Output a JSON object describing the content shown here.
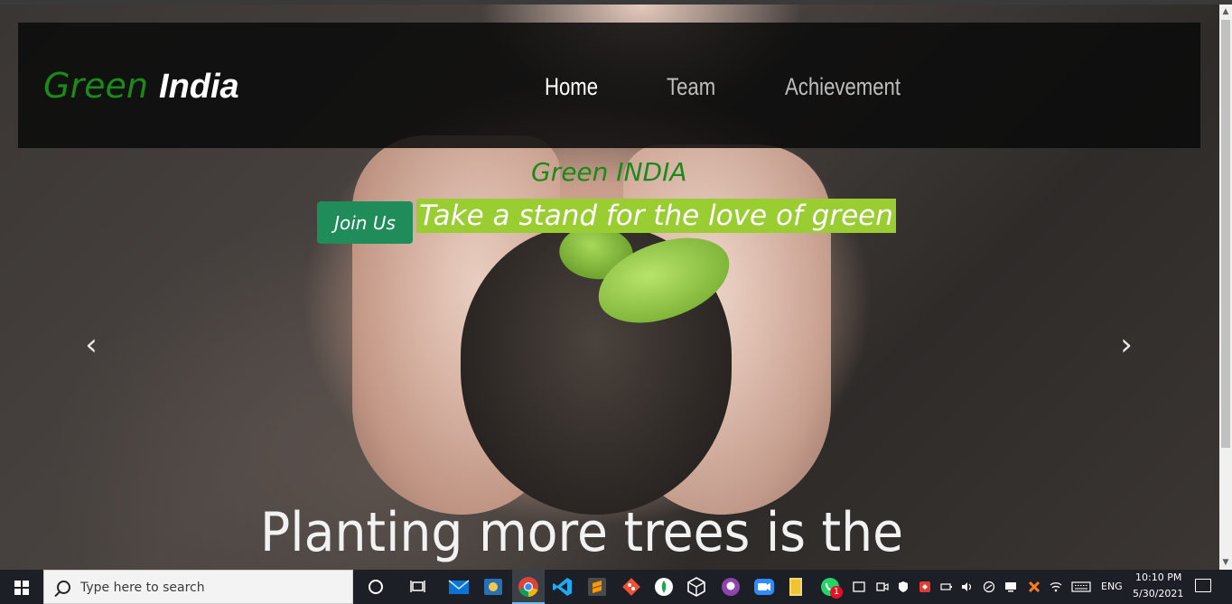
{
  "site": {
    "brand_first": "Green",
    "brand_second": "India",
    "nav": [
      {
        "label": "Home",
        "active": true
      },
      {
        "label": "Team",
        "active": false
      },
      {
        "label": "Achievement",
        "active": false
      }
    ]
  },
  "hero": {
    "subtitle": "Green INDIA",
    "join_label": "Join Us",
    "tagline": "Take a stand for the love of green",
    "caption": "Planting more trees is the",
    "prev_glyph": "‹",
    "next_glyph": "›"
  },
  "colors": {
    "brand_green": "#1a8a1a",
    "button_green": "#1f8c5a",
    "tagline_bg": "#9acd32",
    "navbar_bg": "#0a0a0a"
  },
  "taskbar": {
    "search_placeholder": "Type here to search",
    "apps": [
      "task-view-icon",
      "mail-icon",
      "photos-icon",
      "chrome-icon",
      "vscode-icon",
      "sublime-text-icon",
      "git-icon",
      "mongodb-compass-icon",
      "virtualbox-icon",
      "github-desktop-icon",
      "zoom-icon",
      "file-explorer-icon",
      "whatsapp-icon"
    ],
    "whatsapp_badge": "1",
    "language": "ENG",
    "time": "10:10 PM",
    "date": "5/30/2021"
  }
}
